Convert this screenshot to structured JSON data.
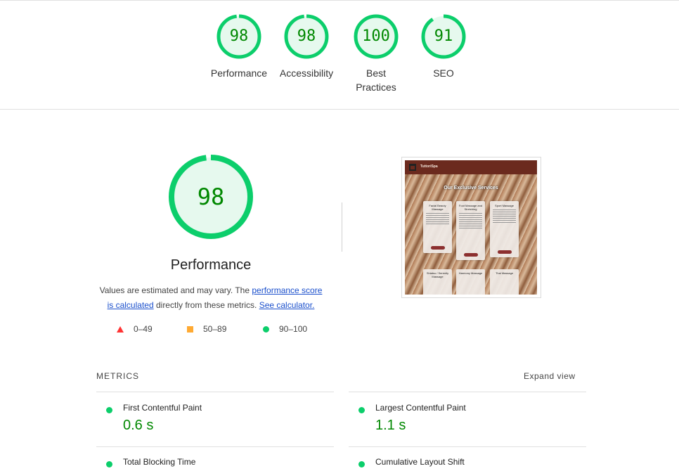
{
  "categories": [
    {
      "score": "98",
      "label": "Performance",
      "fraction": 0.98
    },
    {
      "score": "98",
      "label": "Accessibility",
      "fraction": 0.98
    },
    {
      "score": "100",
      "label": "Best Practices",
      "fraction": 1.0
    },
    {
      "score": "91",
      "label": "SEO",
      "fraction": 0.91
    }
  ],
  "performance": {
    "score": "98",
    "fraction": 0.98,
    "title": "Performance",
    "desc_prefix": "Values are estimated and may vary. The ",
    "link_score": "performance score is calculated",
    "desc_middle": " directly from these metrics. ",
    "link_calc": "See calculator."
  },
  "legend": [
    {
      "range": "0–49",
      "shape": "triangle",
      "color": "#ff3333"
    },
    {
      "range": "50–89",
      "shape": "square",
      "color": "#ffaa33"
    },
    {
      "range": "90–100",
      "shape": "circle",
      "color": "#0cce6b"
    }
  ],
  "screenshot": {
    "brand": "TuttoriSpa",
    "heading": "Our Exclusive Services",
    "cards": [
      "Facial Beauty Massage",
      "Foot Massage and Stretching",
      "Sport Massage"
    ],
    "cards_row2": [
      "Shiatsu / Serenity Massage",
      "Harmony Massage",
      "Thai Massage"
    ]
  },
  "metrics": {
    "header": "METRICS",
    "expand": "Expand view",
    "items": [
      {
        "name": "First Contentful Paint",
        "value": "0.6 s"
      },
      {
        "name": "Largest Contentful Paint",
        "value": "1.1 s"
      },
      {
        "name": "Total Blocking Time",
        "value": ""
      },
      {
        "name": "Cumulative Layout Shift",
        "value": ""
      }
    ]
  },
  "colors": {
    "pass": "#0cce6b",
    "pass_text": "#008800",
    "pass_fill": "#e6f9ee"
  }
}
